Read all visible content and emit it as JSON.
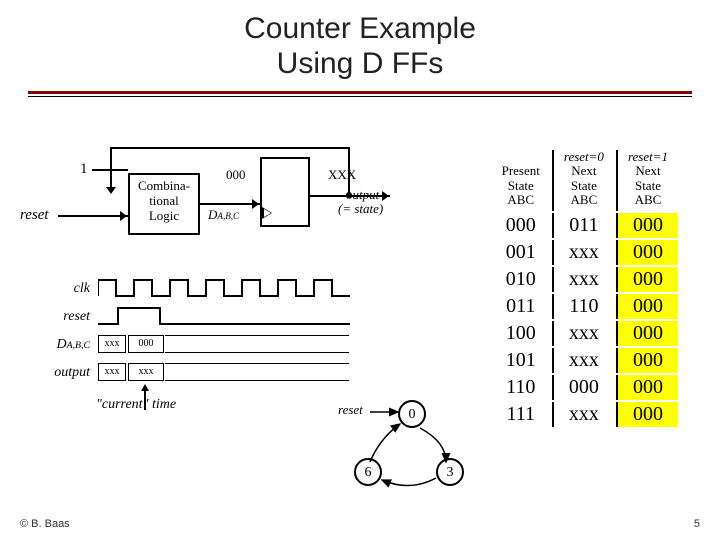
{
  "title_line1": "Counter Example",
  "title_line2": "Using D FFs",
  "diagram": {
    "input_const": "1",
    "reset_label": "reset",
    "logic_box_l1": "Combina-",
    "logic_box_l2": "tional",
    "logic_box_l3": "Logic",
    "ff_top_label": "000",
    "ff_out_label": "XXX",
    "d_label": "D",
    "d_sub": "A,B,C",
    "output_l1": "output",
    "output_l2": "(= state)"
  },
  "timing": {
    "clk": "clk",
    "reset": "reset",
    "d": "D",
    "d_sub": "A,B,C",
    "output": "output",
    "d_vals": [
      "xxx",
      "000"
    ],
    "out_vals": [
      "xxx",
      "xxx"
    ]
  },
  "current_time_label": "\"current\" time",
  "graph": {
    "reset_label": "reset",
    "nodes": [
      "0",
      "6",
      "3"
    ]
  },
  "table": {
    "headers": {
      "present_l1": "Present",
      "present_l2": "State",
      "present_l3": "ABC",
      "r0_l0": "reset=0",
      "next_l1": "Next",
      "next_l2": "State",
      "next_l3": "ABC",
      "r1_l0": "reset=1"
    },
    "rows": [
      {
        "ps": "000",
        "n0": "011",
        "n1": "000"
      },
      {
        "ps": "001",
        "n0": "xxx",
        "n1": "000"
      },
      {
        "ps": "010",
        "n0": "xxx",
        "n1": "000"
      },
      {
        "ps": "011",
        "n0": "110",
        "n1": "000"
      },
      {
        "ps": "100",
        "n0": "xxx",
        "n1": "000"
      },
      {
        "ps": "101",
        "n0": "xxx",
        "n1": "000"
      },
      {
        "ps": "110",
        "n0": "000",
        "n1": "000"
      },
      {
        "ps": "111",
        "n0": "xxx",
        "n1": "000"
      }
    ]
  },
  "footer": {
    "left": "© B. Baas",
    "right": "5"
  }
}
